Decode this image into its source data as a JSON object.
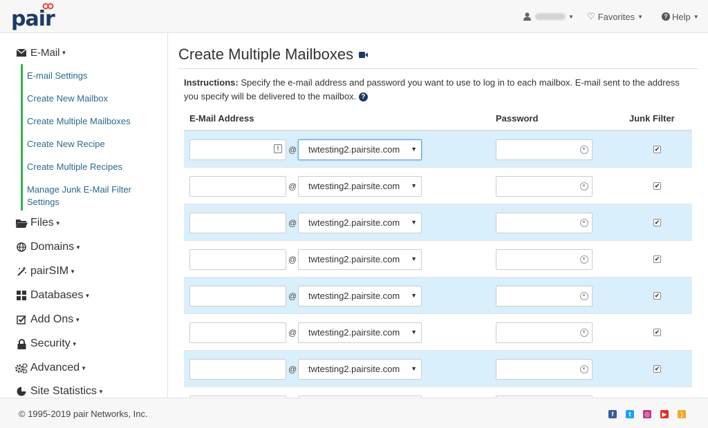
{
  "header": {
    "logo_text": "pair",
    "user_name": "",
    "favorites_label": "Favorites",
    "help_label": "Help"
  },
  "sidebar": {
    "email_label": "E-Mail",
    "email_subitems": [
      "E-mail Settings",
      "Create New Mailbox",
      "Create Multiple Mailboxes",
      "Create New Recipe",
      "Create Multiple Recipes",
      "Manage Junk E-Mail Filter Settings"
    ],
    "items": [
      {
        "label": "Files",
        "icon": "folder-icon"
      },
      {
        "label": "Domains",
        "icon": "globe-icon"
      },
      {
        "label": "pairSIM",
        "icon": "magic-wand-icon"
      },
      {
        "label": "Databases",
        "icon": "grid-icon"
      },
      {
        "label": "Add Ons",
        "icon": "checkbox-icon"
      },
      {
        "label": "Security",
        "icon": "lock-icon"
      },
      {
        "label": "Advanced",
        "icon": "gears-icon"
      },
      {
        "label": "Site Statistics",
        "icon": "pie-chart-icon"
      }
    ]
  },
  "main": {
    "title": "Create Multiple Mailboxes",
    "instructions_label": "Instructions:",
    "instructions_text": " Specify the e-mail address and password you want to use to log in to each mailbox. E-mail sent to the address you specify will be delivered to the mailbox.",
    "columns": {
      "email": "E-Mail Address",
      "password": "Password",
      "junk": "Junk Filter"
    },
    "at_symbol": "@",
    "rows": [
      {
        "email": "",
        "domain": "twtesting2.pairsite.com",
        "password": "",
        "junk_filter": true
      },
      {
        "email": "",
        "domain": "twtesting2.pairsite.com",
        "password": "",
        "junk_filter": true
      },
      {
        "email": "",
        "domain": "twtesting2.pairsite.com",
        "password": "",
        "junk_filter": true
      },
      {
        "email": "",
        "domain": "twtesting2.pairsite.com",
        "password": "",
        "junk_filter": true
      },
      {
        "email": "",
        "domain": "twtesting2.pairsite.com",
        "password": "",
        "junk_filter": true
      },
      {
        "email": "",
        "domain": "twtesting2.pairsite.com",
        "password": "",
        "junk_filter": true
      },
      {
        "email": "",
        "domain": "twtesting2.pairsite.com",
        "password": "",
        "junk_filter": true
      },
      {
        "email": "",
        "domain": "",
        "password": "",
        "junk_filter": false
      }
    ]
  },
  "footer": {
    "copyright": "© 1995-2019 pair Networks, Inc.",
    "social": [
      {
        "icon": "facebook-icon",
        "color": "#3b5998"
      },
      {
        "icon": "twitter-icon",
        "color": "#1da1f2"
      },
      {
        "icon": "instagram-icon",
        "color": "#c13584"
      },
      {
        "icon": "youtube-icon",
        "color": "#e52d27"
      },
      {
        "icon": "rss-icon",
        "color": "#f5a623"
      }
    ]
  },
  "colors": {
    "brand": "#1d3a66",
    "accent_green": "#2fb44a",
    "row_highlight": "#d9effb",
    "link": "#2a6a8a"
  }
}
